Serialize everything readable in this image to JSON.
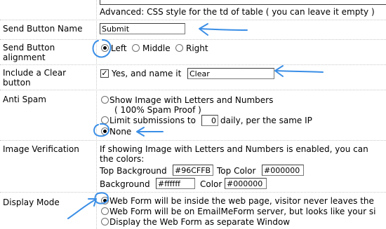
{
  "advanced_note": "Advanced: CSS style for the td of table ( you can leave it empty )",
  "send_button_name": {
    "label": "Send Button Name",
    "value": "Submit"
  },
  "send_button_alignment": {
    "label": "Send Button alignment",
    "options": [
      "Left",
      "Middle",
      "Right"
    ],
    "selected": "Left"
  },
  "clear_button": {
    "label": "Include a Clear button",
    "checkbox_label": "Yes, and name it",
    "checked": true,
    "value": "Clear"
  },
  "anti_spam": {
    "label": "Anti Spam",
    "option_image_line1": "Show Image with Letters and Numbers",
    "option_image_line2": "( 100% Spam Proof )",
    "option_limit_prefix": "Limit submissions to",
    "option_limit_value": "0",
    "option_limit_suffix": "daily, per the same IP",
    "option_none": "None",
    "selected": "None"
  },
  "image_verification": {
    "label": "Image Verification",
    "description_line1": "If showing Image with Letters and Numbers is enabled, you can",
    "description_line2": "the colors:",
    "top_background_label": "Top Background",
    "top_background_value": "#96CFFB",
    "top_color_label": "Top Color",
    "top_color_value": "#000000",
    "background_label": "Background",
    "background_value": "#ffffff",
    "color_label": "Color",
    "color_value": "#000000"
  },
  "display_mode": {
    "label": "Display Mode",
    "option_inside": "Web Form will be inside the web page, visitor never leaves the",
    "option_server": "Web Form will be on EmailMeForm server, but looks like your si",
    "option_window": "Display the Web Form as separate Window",
    "selected": "inside"
  },
  "annotation_color": "#3a8ee6"
}
